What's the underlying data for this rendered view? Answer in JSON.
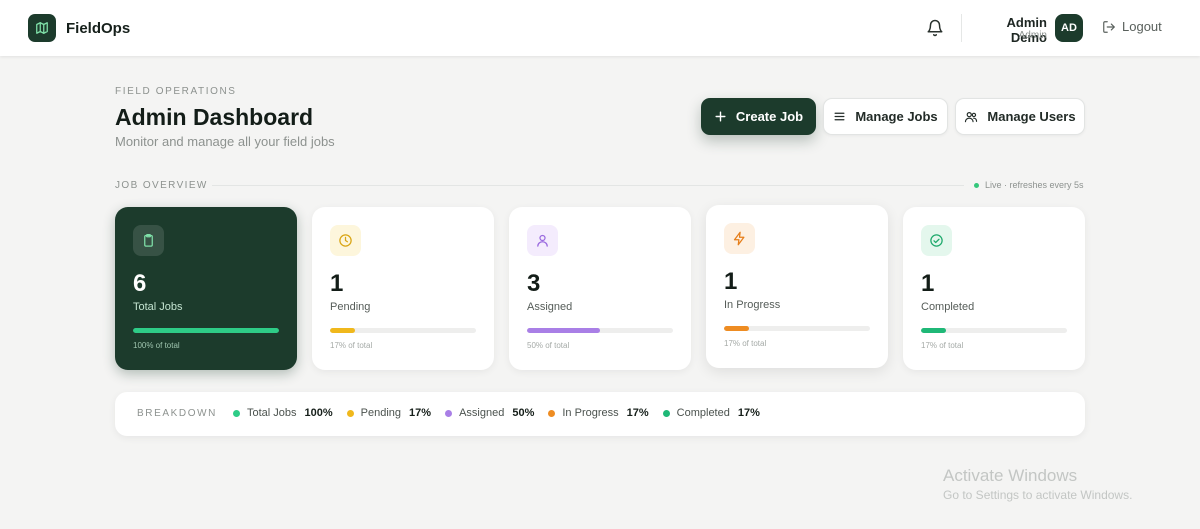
{
  "header": {
    "brand": "FieldOps",
    "user_name": "Admin Demo",
    "user_role": "Admin",
    "avatar_initials": "AD",
    "logout_label": "Logout"
  },
  "page": {
    "eyebrow": "FIELD OPERATIONS",
    "title": "Admin Dashboard",
    "subtitle": "Monitor and manage all your field jobs"
  },
  "actions": {
    "create_job": "Create Job",
    "manage_jobs": "Manage Jobs",
    "manage_users": "Manage Users"
  },
  "overview": {
    "label": "JOB OVERVIEW",
    "live_text": "Live · refreshes every 5s"
  },
  "cards": [
    {
      "value": "6",
      "label": "Total Jobs",
      "note": "100% of total",
      "fraction": 1.0,
      "color": "#2ecc87",
      "icon": "clipboard-icon"
    },
    {
      "value": "1",
      "label": "Pending",
      "note": "17% of total",
      "fraction": 0.17,
      "color": "#f0b81c",
      "icon": "clock-icon"
    },
    {
      "value": "3",
      "label": "Assigned",
      "note": "50% of total",
      "fraction": 0.5,
      "color": "#a97fe6",
      "icon": "user-icon"
    },
    {
      "value": "1",
      "label": "In Progress",
      "note": "17% of total",
      "fraction": 0.17,
      "color": "#ee8c22",
      "icon": "bolt-icon"
    },
    {
      "value": "1",
      "label": "Completed",
      "note": "17% of total",
      "fraction": 0.17,
      "color": "#1fb877",
      "icon": "check-circle-icon"
    }
  ],
  "breakdown": {
    "title": "BREAKDOWN",
    "items": [
      {
        "label": "Total Jobs",
        "value": "100%",
        "color": "#2ecc87"
      },
      {
        "label": "Pending",
        "value": "17%",
        "color": "#f0b81c"
      },
      {
        "label": "Assigned",
        "value": "50%",
        "color": "#a97fe6"
      },
      {
        "label": "In Progress",
        "value": "17%",
        "color": "#ee8c22"
      },
      {
        "label": "Completed",
        "value": "17%",
        "color": "#1fb877"
      }
    ]
  },
  "watermark": {
    "title": "Activate Windows",
    "subtitle": "Go to Settings to activate Windows."
  }
}
